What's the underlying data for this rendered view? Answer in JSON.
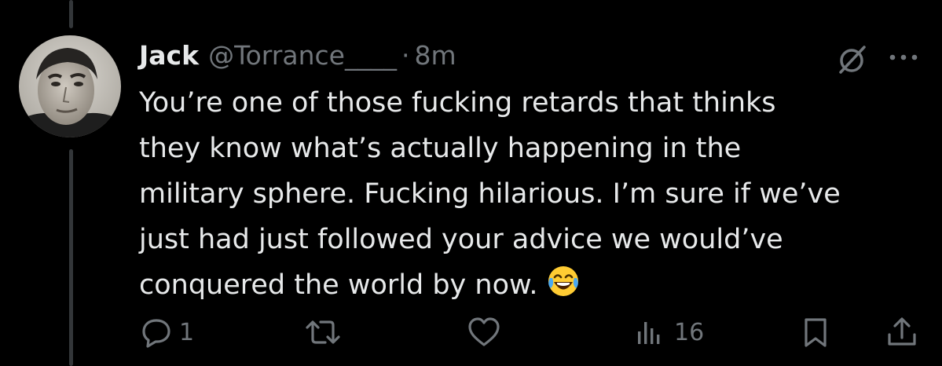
{
  "tweet": {
    "author_name": "Jack",
    "author_handle": "@Torrance____",
    "separator": "·",
    "timestamp": "8m",
    "text_lines": [
      "You’re one of those fucking retards that thinks",
      "they know what’s actually happening in the",
      "military sphere. Fucking hilarious. I’m sure if we’ve",
      "just had just followed your advice we would’ve",
      "conquered the world by now."
    ],
    "emoji": "face-with-tears-of-joy"
  },
  "actions": {
    "reply_count": "1",
    "retweet_count": "",
    "like_count": "",
    "views_count": "16"
  },
  "icons": {
    "reply": "reply-icon",
    "retweet": "retweet-icon",
    "like": "heart-icon",
    "views": "views-icon",
    "bookmark": "bookmark-icon",
    "share": "share-icon",
    "grok": "grok-icon",
    "more": "more-icon"
  },
  "colors": {
    "background": "#000000",
    "text_primary": "#e7e9ea",
    "text_secondary": "#71767b",
    "thread_line": "#333639"
  }
}
